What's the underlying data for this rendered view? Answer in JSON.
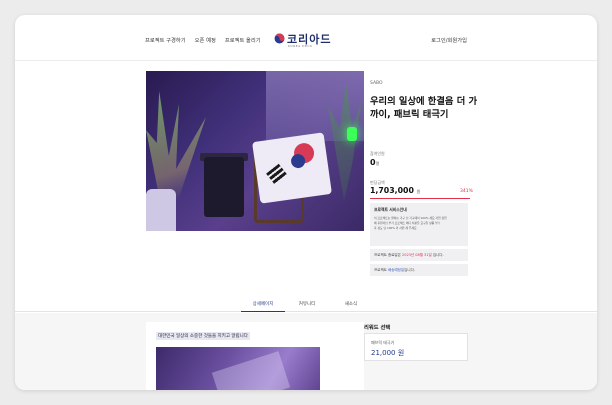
{
  "header": {
    "nav": [
      "프로젝트 구경하기",
      "오픈 예정",
      "프로젝트 올리기"
    ],
    "logo_text": "코리아드",
    "logo_sub": "KOREA DECK",
    "login_label": "로그인/회원가입"
  },
  "product": {
    "brand": "SABO",
    "title": "우리의 일상에 한결음 더 가까이, 패브릭 태극기",
    "supporters_label": "참여인원",
    "supporters_value": "0",
    "supporters_unit": "명",
    "amount_label": "펀딩금액",
    "amount_value": "1,703,000",
    "amount_unit": "원",
    "rate": "341%",
    "progress_fraction": 1.0,
    "notice_title": "프로젝트 서비스안내",
    "notice_lines": [
      "이 프로젝트는 원하는 가구 선 가구에서 100% 세요 자립 정립",
      "배 후원자님 부가 프로젝트 메디 치분들 요구들 상품 부수",
      "후 정도 당 100% 카 사원 제 주세요"
    ],
    "period_text": "프로젝트 종료일은",
    "period_date": "2023년 08월 31일",
    "period_suffix": "입니다.",
    "delivery_text": "프로젝트",
    "delivery_highlight": "배송예정일",
    "delivery_suffix": "입니다."
  },
  "tabs": [
    "상세페이지",
    "커뮤니티",
    "새소식"
  ],
  "active_tab": 0,
  "story": {
    "caption": "대한민국 일상의 소중한 것들을 지키고 알립니다"
  },
  "rewards": {
    "title": "리워드 선택",
    "items": [
      {
        "name": "패브릭 태극기",
        "price": "21,000 원"
      }
    ]
  },
  "colors": {
    "accent": "#1e3a8a",
    "highlight": "#e0304a"
  }
}
